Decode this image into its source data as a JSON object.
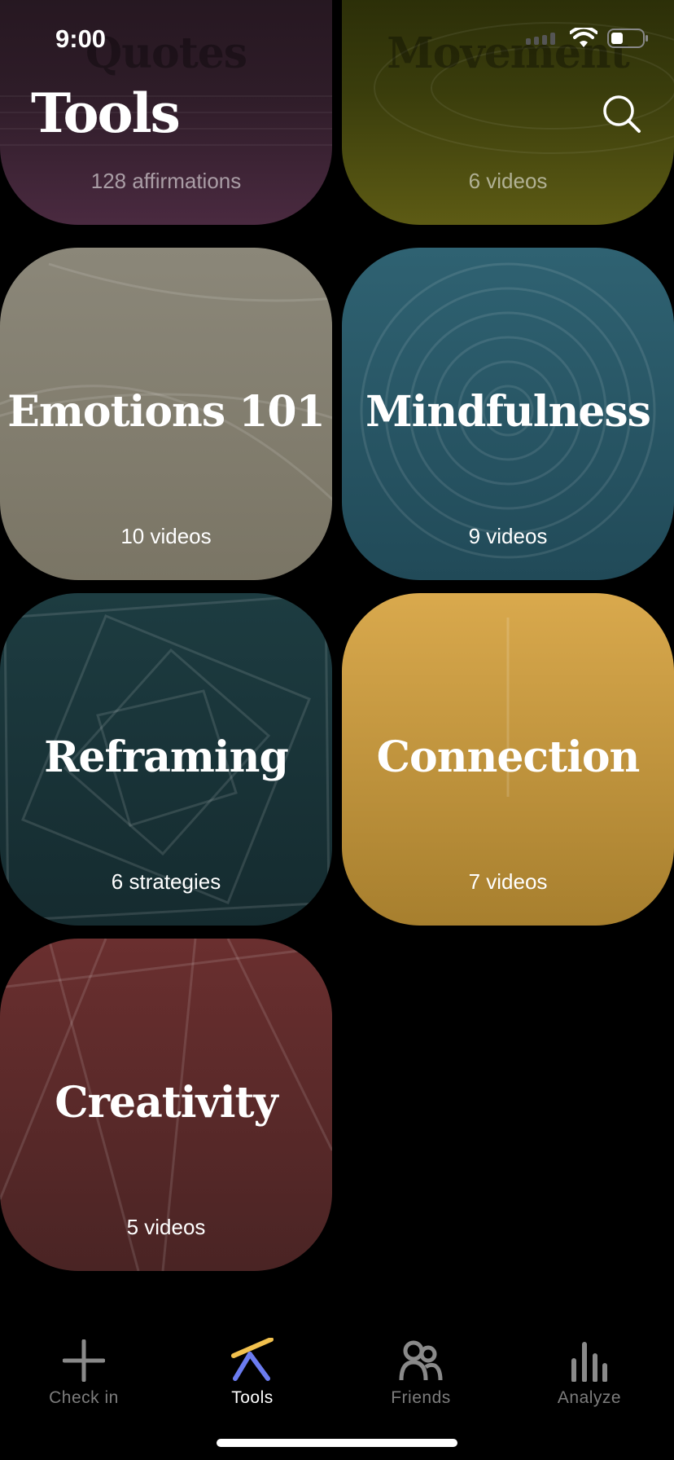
{
  "status_bar": {
    "time": "9:00"
  },
  "header": {
    "title": "Tools"
  },
  "tiles": [
    {
      "title": "Quotes",
      "subtitle": "128 affirmations"
    },
    {
      "title": "Movement",
      "subtitle": "6 videos"
    },
    {
      "title": "Emotions 101",
      "subtitle": "10 videos"
    },
    {
      "title": "Mindfulness",
      "subtitle": "9 videos"
    },
    {
      "title": "Reframing",
      "subtitle": "6 strategies"
    },
    {
      "title": "Connection",
      "subtitle": "7 videos"
    },
    {
      "title": "Creativity",
      "subtitle": "5 videos"
    }
  ],
  "tabbar": {
    "items": [
      {
        "label": "Check in",
        "icon": "plus-icon"
      },
      {
        "label": "Tools",
        "icon": "tools-icon",
        "active": true
      },
      {
        "label": "Friends",
        "icon": "friends-icon"
      },
      {
        "label": "Analyze",
        "icon": "bars-icon"
      }
    ]
  },
  "colors": {
    "quotes": "#2e1c28",
    "movement": "#3a3d0c",
    "emotions": "#8b8779",
    "mindfulness": "#2f6272",
    "reframing": "#1d3c41",
    "connection": "#d9a94d",
    "creativity": "#5a2a2a",
    "tools_icon_yellow": "#f2c14e",
    "tools_icon_blue": "#6b7cf0"
  }
}
